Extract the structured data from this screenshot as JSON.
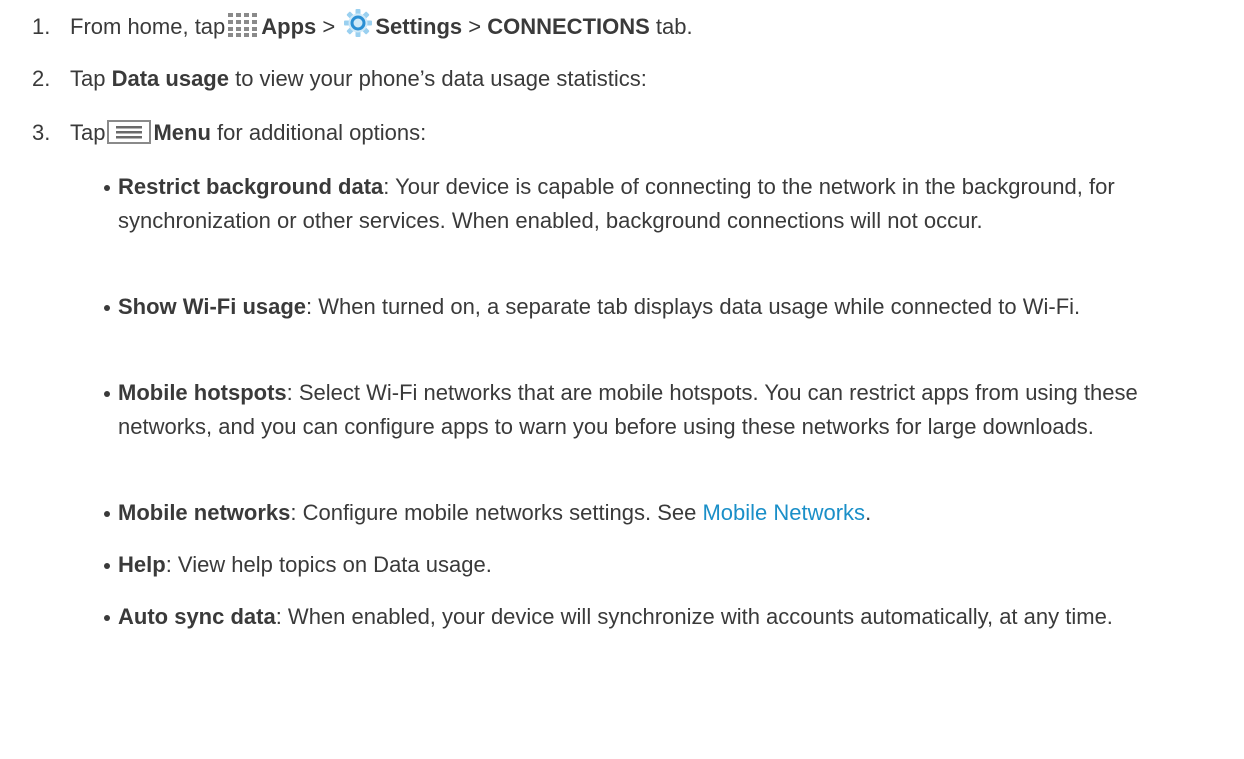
{
  "steps": [
    {
      "number": "1.",
      "text_before": "From home, tap",
      "apps_label": "Apps",
      "sep1": " > ",
      "settings_label": "Settings",
      "sep2": " > ",
      "connections_label": "CONNECTIONS",
      "text_after": " tab."
    },
    {
      "number": "2.",
      "text_before": "Tap ",
      "bold": "Data usage",
      "text_after": " to view your phone’s data usage statistics:"
    },
    {
      "number": "3.",
      "text_before": "Tap",
      "bold": "Menu",
      "text_after": " for additional options:"
    }
  ],
  "options": [
    {
      "term": "Restrict background data",
      "desc": ": Your device is capable of connecting to the network in the background, for synchronization or other services. When enabled, background connections will not occur."
    },
    {
      "term": "Show Wi-Fi usage",
      "desc": ": When turned on, a separate tab displays data usage while connected to Wi-Fi."
    },
    {
      "term": "Mobile hotspots",
      "desc": ": Select Wi-Fi networks that are mobile hotspots. You can restrict apps from using these networks, and you can configure apps to warn you before using these networks for large downloads."
    },
    {
      "term": "Mobile networks",
      "desc": ": Configure mobile networks settings. See ",
      "link": "Mobile Networks",
      "tail": "."
    },
    {
      "term": "Help",
      "desc": ": View help topics on Data usage."
    },
    {
      "term": "Auto sync data",
      "desc": ": When enabled, your device will synchronize with accounts automatically, at any time."
    }
  ],
  "icons": {
    "apps": "apps-grid-icon",
    "settings": "settings-gear-icon",
    "menu": "menu-icon"
  },
  "colors": {
    "text": "#3a3a3a",
    "link": "#1a8fc8",
    "settings_icon": "#4aa3df"
  }
}
